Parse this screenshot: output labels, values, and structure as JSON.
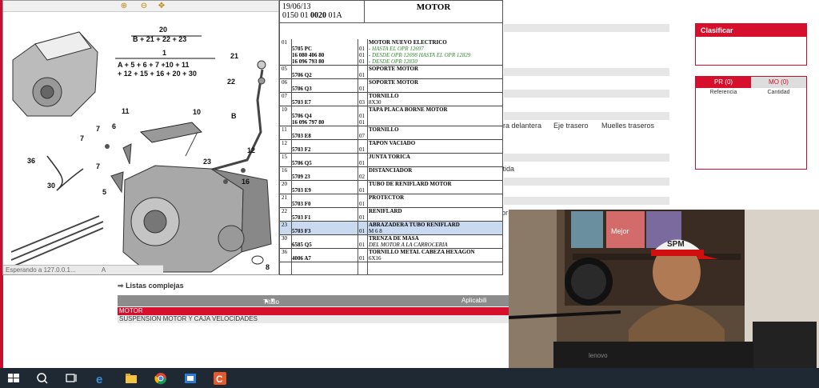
{
  "diagram": {
    "status_text": "Esperando a 127.0.0.1...",
    "status_extra": "A",
    "formula_top": "20",
    "formula_top_sub": "B + 21 + 22 + 23",
    "formula_mid": "1",
    "formula_bottom_1": "A + 5 + 6 + 7 +10 + 11",
    "formula_bottom_2": "+ 12 + 15 + 16 + 20 + 30",
    "labels": [
      "21",
      "22",
      "10",
      "B",
      "11",
      "7",
      "6",
      "7",
      "36",
      "30",
      "23",
      "12",
      "16",
      "7",
      "5",
      "8"
    ]
  },
  "parts_table": {
    "date": "19/06/13",
    "code_prefix": "0150 01",
    "code_bold": "0020",
    "code_suffix": "01A",
    "title": "MOTOR",
    "rows": [
      {
        "idx": "01",
        "refs": [
          "5705 PC",
          "16 080 406 80",
          "16 096 793 80"
        ],
        "qtys": [
          "01",
          "01",
          "01"
        ],
        "title": "MOTOR NUEVO ELECTRICO",
        "notes": [
          "- HASTA EL OPR 12697",
          "- DESDE OPR 12698 HASTA EL OPR 12829",
          "- DESDE OPR 12830"
        ],
        "notes_green": true
      },
      {
        "idx": "05",
        "refs": [
          "5706 Q2"
        ],
        "qtys": [
          "01"
        ],
        "title": "SOPORTE MOTOR",
        "notes": []
      },
      {
        "idx": "06",
        "refs": [
          "5706 Q3"
        ],
        "qtys": [
          "01"
        ],
        "title": "SOPORTE MOTOR",
        "notes": []
      },
      {
        "idx": "07",
        "refs": [
          "5703 E7"
        ],
        "qtys": [
          "03"
        ],
        "title": "TORNILLO",
        "notes": [
          "8X30"
        ]
      },
      {
        "idx": "10",
        "refs": [
          "5706 Q4",
          "16 096 797 80"
        ],
        "qtys": [
          "01",
          "01"
        ],
        "title": "TAPA PLACA BORNE MOTOR",
        "notes": []
      },
      {
        "idx": "11",
        "refs": [
          "5703 E8"
        ],
        "qtys": [
          "07"
        ],
        "title": "TORNILLO",
        "notes": []
      },
      {
        "idx": "12",
        "refs": [
          "5703 F2"
        ],
        "qtys": [
          "01"
        ],
        "title": "TAPON VACIADO",
        "notes": []
      },
      {
        "idx": "15",
        "refs": [
          "5706 Q5"
        ],
        "qtys": [
          "01"
        ],
        "title": "JUNTA TORICA",
        "notes": []
      },
      {
        "idx": "16",
        "refs": [
          "5709 23"
        ],
        "qtys": [
          "02"
        ],
        "title": "DISTANCIADOR",
        "notes": []
      },
      {
        "idx": "20",
        "refs": [
          "5703 E9"
        ],
        "qtys": [
          "01"
        ],
        "title": "TUBO DE RENIFLARD MOTOR",
        "notes": []
      },
      {
        "idx": "21",
        "refs": [
          "5703 F0"
        ],
        "qtys": [
          "01"
        ],
        "title": "PROTECTOR",
        "notes": []
      },
      {
        "idx": "22",
        "refs": [
          "5703 F1"
        ],
        "qtys": [
          "01"
        ],
        "title": "RENIFLARD",
        "notes": []
      },
      {
        "idx": "23",
        "refs": [
          "5703 F3"
        ],
        "qtys": [
          "01"
        ],
        "title": "ABRAZADERA TUBO RENIFLARD",
        "notes": [
          "M 6 8"
        ]
      },
      {
        "idx": "30",
        "refs": [
          "6585 Q5"
        ],
        "qtys": [
          "01"
        ],
        "title": "TRENZA DE MASA",
        "notes": [
          "DEL MOTOR A LA CARROCERIA"
        ],
        "notes_italic": true
      },
      {
        "idx": "36",
        "refs": [
          "4006 A7"
        ],
        "qtys": [
          "01"
        ],
        "title": "TORNILLO METAL CABEZA HEXAGON",
        "notes": [
          "6X16"
        ]
      }
    ]
  },
  "background": {
    "nav_links": [
      "ra delantera",
      "Eje trasero",
      "Muelles traseros"
    ],
    "partial_text_1": "ttida",
    "partial_text_2": "or"
  },
  "classify_panel": {
    "title": "Clasificar"
  },
  "cart_panel": {
    "tab_pr": "PR (0)",
    "tab_mo": "MO (0)",
    "col_ref": "Referencia",
    "col_qty": "Cantidad"
  },
  "lists": {
    "heading": "Listas complejas",
    "col_title": "Título",
    "col_app": "Aplicabili",
    "rows": [
      "MOTOR",
      "SUSPENSION MOTOR Y CAJA VELOCIDADES"
    ]
  },
  "webcam": {
    "cap_text": "SPM",
    "laptop_brand": "lenovo",
    "magazine": "Mejor"
  },
  "colors": {
    "accent": "#d6102c",
    "highlight": "#c9d9ef"
  }
}
